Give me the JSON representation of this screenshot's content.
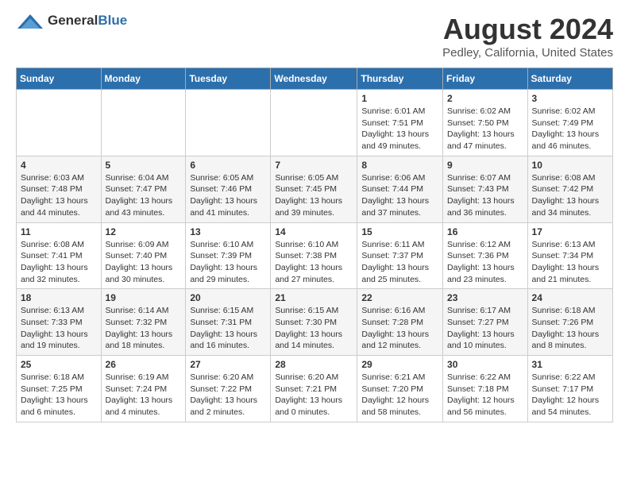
{
  "header": {
    "logo_general": "General",
    "logo_blue": "Blue",
    "month_title": "August 2024",
    "location": "Pedley, California, United States"
  },
  "days_of_week": [
    "Sunday",
    "Monday",
    "Tuesday",
    "Wednesday",
    "Thursday",
    "Friday",
    "Saturday"
  ],
  "weeks": [
    [
      {
        "day": "",
        "info": ""
      },
      {
        "day": "",
        "info": ""
      },
      {
        "day": "",
        "info": ""
      },
      {
        "day": "",
        "info": ""
      },
      {
        "day": "1",
        "info": "Sunrise: 6:01 AM\nSunset: 7:51 PM\nDaylight: 13 hours\nand 49 minutes."
      },
      {
        "day": "2",
        "info": "Sunrise: 6:02 AM\nSunset: 7:50 PM\nDaylight: 13 hours\nand 47 minutes."
      },
      {
        "day": "3",
        "info": "Sunrise: 6:02 AM\nSunset: 7:49 PM\nDaylight: 13 hours\nand 46 minutes."
      }
    ],
    [
      {
        "day": "4",
        "info": "Sunrise: 6:03 AM\nSunset: 7:48 PM\nDaylight: 13 hours\nand 44 minutes."
      },
      {
        "day": "5",
        "info": "Sunrise: 6:04 AM\nSunset: 7:47 PM\nDaylight: 13 hours\nand 43 minutes."
      },
      {
        "day": "6",
        "info": "Sunrise: 6:05 AM\nSunset: 7:46 PM\nDaylight: 13 hours\nand 41 minutes."
      },
      {
        "day": "7",
        "info": "Sunrise: 6:05 AM\nSunset: 7:45 PM\nDaylight: 13 hours\nand 39 minutes."
      },
      {
        "day": "8",
        "info": "Sunrise: 6:06 AM\nSunset: 7:44 PM\nDaylight: 13 hours\nand 37 minutes."
      },
      {
        "day": "9",
        "info": "Sunrise: 6:07 AM\nSunset: 7:43 PM\nDaylight: 13 hours\nand 36 minutes."
      },
      {
        "day": "10",
        "info": "Sunrise: 6:08 AM\nSunset: 7:42 PM\nDaylight: 13 hours\nand 34 minutes."
      }
    ],
    [
      {
        "day": "11",
        "info": "Sunrise: 6:08 AM\nSunset: 7:41 PM\nDaylight: 13 hours\nand 32 minutes."
      },
      {
        "day": "12",
        "info": "Sunrise: 6:09 AM\nSunset: 7:40 PM\nDaylight: 13 hours\nand 30 minutes."
      },
      {
        "day": "13",
        "info": "Sunrise: 6:10 AM\nSunset: 7:39 PM\nDaylight: 13 hours\nand 29 minutes."
      },
      {
        "day": "14",
        "info": "Sunrise: 6:10 AM\nSunset: 7:38 PM\nDaylight: 13 hours\nand 27 minutes."
      },
      {
        "day": "15",
        "info": "Sunrise: 6:11 AM\nSunset: 7:37 PM\nDaylight: 13 hours\nand 25 minutes."
      },
      {
        "day": "16",
        "info": "Sunrise: 6:12 AM\nSunset: 7:36 PM\nDaylight: 13 hours\nand 23 minutes."
      },
      {
        "day": "17",
        "info": "Sunrise: 6:13 AM\nSunset: 7:34 PM\nDaylight: 13 hours\nand 21 minutes."
      }
    ],
    [
      {
        "day": "18",
        "info": "Sunrise: 6:13 AM\nSunset: 7:33 PM\nDaylight: 13 hours\nand 19 minutes."
      },
      {
        "day": "19",
        "info": "Sunrise: 6:14 AM\nSunset: 7:32 PM\nDaylight: 13 hours\nand 18 minutes."
      },
      {
        "day": "20",
        "info": "Sunrise: 6:15 AM\nSunset: 7:31 PM\nDaylight: 13 hours\nand 16 minutes."
      },
      {
        "day": "21",
        "info": "Sunrise: 6:15 AM\nSunset: 7:30 PM\nDaylight: 13 hours\nand 14 minutes."
      },
      {
        "day": "22",
        "info": "Sunrise: 6:16 AM\nSunset: 7:28 PM\nDaylight: 13 hours\nand 12 minutes."
      },
      {
        "day": "23",
        "info": "Sunrise: 6:17 AM\nSunset: 7:27 PM\nDaylight: 13 hours\nand 10 minutes."
      },
      {
        "day": "24",
        "info": "Sunrise: 6:18 AM\nSunset: 7:26 PM\nDaylight: 13 hours\nand 8 minutes."
      }
    ],
    [
      {
        "day": "25",
        "info": "Sunrise: 6:18 AM\nSunset: 7:25 PM\nDaylight: 13 hours\nand 6 minutes."
      },
      {
        "day": "26",
        "info": "Sunrise: 6:19 AM\nSunset: 7:24 PM\nDaylight: 13 hours\nand 4 minutes."
      },
      {
        "day": "27",
        "info": "Sunrise: 6:20 AM\nSunset: 7:22 PM\nDaylight: 13 hours\nand 2 minutes."
      },
      {
        "day": "28",
        "info": "Sunrise: 6:20 AM\nSunset: 7:21 PM\nDaylight: 13 hours\nand 0 minutes."
      },
      {
        "day": "29",
        "info": "Sunrise: 6:21 AM\nSunset: 7:20 PM\nDaylight: 12 hours\nand 58 minutes."
      },
      {
        "day": "30",
        "info": "Sunrise: 6:22 AM\nSunset: 7:18 PM\nDaylight: 12 hours\nand 56 minutes."
      },
      {
        "day": "31",
        "info": "Sunrise: 6:22 AM\nSunset: 7:17 PM\nDaylight: 12 hours\nand 54 minutes."
      }
    ]
  ]
}
